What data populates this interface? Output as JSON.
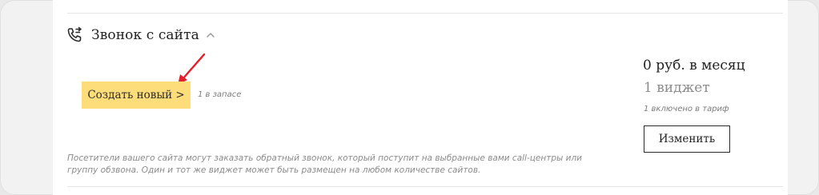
{
  "widget": {
    "title": "Звонок с сайта",
    "icons": {
      "phone": "phone-icon",
      "collapse": "chevron-up-icon"
    },
    "create_button_label": "Создать новый >",
    "stock_text": "1 в запасе",
    "price_text": "0 руб. в месяц",
    "widget_count_text": "1 виджет",
    "included_text": "1 включено в тариф",
    "change_button_label": "Изменить",
    "description_line1": "Посетители вашего сайта могут заказать обратный звонок, который поступит на выбранные вами call-центры или",
    "description_line2": "группу обзвона. Один и тот же виджет может быть размещен на любом количестве сайтов."
  },
  "colors": {
    "accent_button": "#fddc7a",
    "annotation_arrow": "#e2202b",
    "muted_text": "#8c8c8c"
  }
}
